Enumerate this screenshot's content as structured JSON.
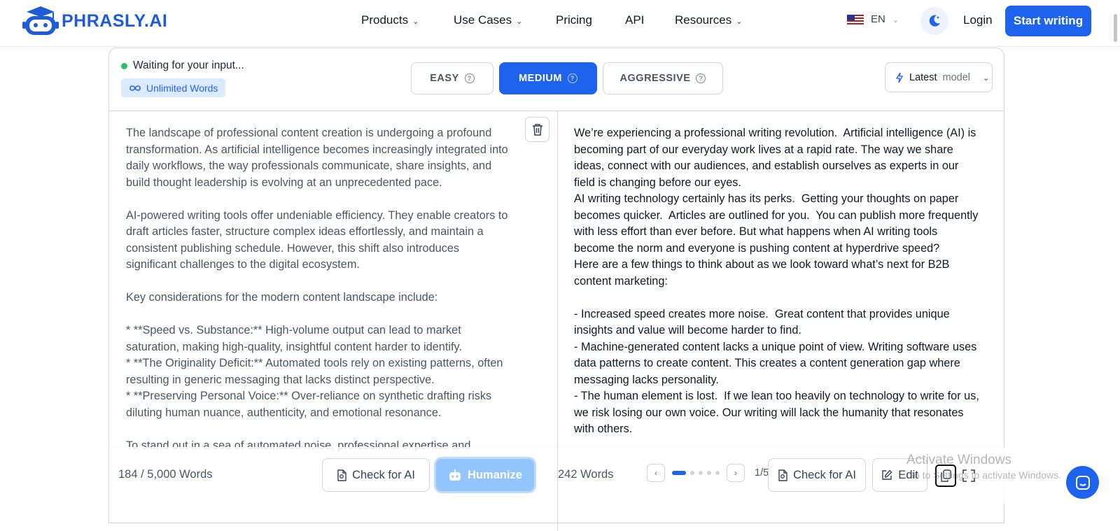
{
  "nav": {
    "logo_text": "PHRASLY.AI",
    "links": [
      {
        "label": "Products",
        "has_dropdown": true
      },
      {
        "label": "Use Cases",
        "has_dropdown": true
      },
      {
        "label": "Pricing",
        "has_dropdown": false
      },
      {
        "label": "API",
        "has_dropdown": false
      },
      {
        "label": "Resources",
        "has_dropdown": true
      }
    ],
    "language": "EN",
    "login_label": "Login",
    "start_label": "Start writing"
  },
  "editor": {
    "status_text": "Waiting for your input...",
    "unlimited_label": "Unlimited Words",
    "modes": [
      {
        "label": "EASY",
        "active": false
      },
      {
        "label": "MEDIUM",
        "active": true
      },
      {
        "label": "AGGRESSIVE",
        "active": false
      }
    ],
    "model_label": "Latest",
    "model_sub": "model",
    "input_text": "The landscape of professional content creation is undergoing a profound transformation. As artificial intelligence becomes increasingly integrated into daily workflows, the way professionals communicate, share insights, and build thought leadership is evolving at an unprecedented pace.\n\nAI-powered writing tools offer undeniable efficiency. They enable creators to draft articles faster, structure complex ideas effortlessly, and maintain a consistent publishing schedule. However, this shift also introduces significant challenges to the digital ecosystem.\n\nKey considerations for the modern content landscape include:\n\n* **Speed vs. Substance:** High-volume output can lead to market saturation, making high-quality, insightful content harder to identify.\n* **The Originality Deficit:** Automated tools rely on existing patterns, often resulting in generic messaging that lacks distinct perspective.\n* **Preserving Personal Voice:** Over-reliance on synthetic drafting risks diluting human nuance, authenticity, and emotional resonance.\n\nTo stand out in a sea of automated noise, professional expertise and",
    "output_text": "We’re experiencing a professional writing revolution.  Artificial intelligence (AI) is becoming part of our everyday work lives at a rapid rate. The way we share ideas, connect with our audiences, and establish ourselves as experts in our field is changing before our eyes.\nAI writing technology certainly has its perks.  Getting your thoughts on paper becomes quicker.  Articles are outlined for you.  You can publish more frequently with less effort than ever before. But what happens when AI writing tools become the norm and everyone is pushing content at hyperdrive speed?\nHere are a few things to think about as we look toward what’s next for B2B content marketing:\n\n- Increased speed creates more noise.  Great content that provides unique insights and value will become harder to find.\n- Machine-generated content lacks a unique point of view. Writing software uses data patterns to create content. This creates a content generation gap where messaging lacks personality.\n- The human element is lost.  If we lean too heavily on technology to write for us, we risk losing our own voice. Our writing will lack the humanity that resonates with others.",
    "input_word_count": "184 / 5,000 Words",
    "output_word_count": "242 Words",
    "check_ai_label": "Check for AI",
    "humanize_label": "Humanize",
    "page_indicator": "1/5",
    "page_count": 5,
    "page_current": 1,
    "edit_label": "Edit"
  },
  "watermark": {
    "line1": "Activate Windows",
    "line2": "Go to Settings to activate Windows."
  },
  "colors": {
    "brand": "#1d63ed",
    "status_dot": "#22c55e",
    "humanize": "#93c5fd"
  }
}
